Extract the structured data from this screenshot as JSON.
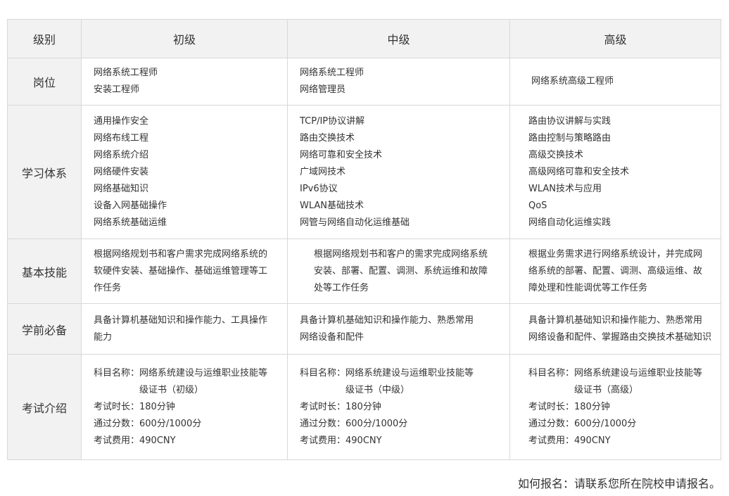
{
  "header": {
    "corner": "级别",
    "levels": [
      "初级",
      "中级",
      "高级"
    ]
  },
  "rows": {
    "position": {
      "label": "岗位",
      "cells": [
        [
          "网络系统工程师",
          "安装工程师"
        ],
        [
          "网络系统工程师",
          "网络管理员"
        ],
        [
          "网络系统高级工程师"
        ]
      ]
    },
    "curriculum": {
      "label": "学习体系",
      "cells": [
        [
          "通用操作安全",
          "网络布线工程",
          "网络系统介绍",
          "网络硬件安装",
          "网络基础知识",
          "设备入网基础操作",
          "网络系统基础运维"
        ],
        [
          "TCP/IP协议讲解",
          "路由交换技术",
          "网络可靠和安全技术",
          "广域网技术",
          "IPv6协议",
          "WLAN基础技术",
          "网管与网络自动化运维基础"
        ],
        [
          "路由协议讲解与实践",
          "路由控制与策略路由",
          "高级交换技术",
          "高级网络可靠和安全技术",
          "WLAN技术与应用",
          "QoS",
          "网络自动化运维实践"
        ]
      ]
    },
    "skills": {
      "label": "基本技能",
      "cells": [
        [
          "根据网络规划书和客户需求完成网络系统的",
          "软硬件安装、基础操作、基础运维管理等工",
          "作任务"
        ],
        [
          "根据网络规划书和客户的需求完成网络系统",
          "安装、部署、配置、调测、系统运维和故障",
          "处等工作任务"
        ],
        [
          "根据业务需求进行网络系统设计，并完成网",
          "络系统的部署、配置、调测、高级运维、故",
          "障处理和性能调优等工作任务"
        ]
      ]
    },
    "prerequisites": {
      "label": "学前必备",
      "cells": [
        [
          "具备计算机基础知识和操作能力、工具操作",
          "能力"
        ],
        [
          "具备计算机基础知识和操作能力、熟悉常用",
          "网络设备和配件"
        ],
        [
          "具备计算机基础知识和操作能力、熟悉常用",
          "网络设备和配件、掌握路由交换技术基础知识"
        ]
      ]
    },
    "exam": {
      "label": "考试介绍",
      "labels": {
        "subject": "科目名称：",
        "duration": "考试时长：",
        "pass": "通过分数：",
        "fee": "考试费用："
      },
      "cells": [
        {
          "subject_line1": "网络系统建设与运维职业技能等",
          "subject_line2": "级证书（初级）",
          "duration": "180分钟",
          "pass": "600分/1000分",
          "fee": "490CNY"
        },
        {
          "subject_line1": "网络系统建设与运维职业技能等",
          "subject_line2": "级证书（中级）",
          "duration": "180分钟",
          "pass": "600分/1000分",
          "fee": "490CNY"
        },
        {
          "subject_line1": "网络系统建设与运维职业技能等",
          "subject_line2": "级证书（高级）",
          "duration": "180分钟",
          "pass": "600分/1000分",
          "fee": "490CNY"
        }
      ]
    }
  },
  "footer": {
    "text": "如何报名：请联系您所在院校申请报名。"
  }
}
